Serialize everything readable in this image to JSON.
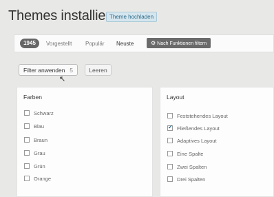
{
  "header": {
    "title": "Themes installieren",
    "upload_label": "Theme hochladen"
  },
  "filterbar": {
    "count": "1945",
    "tabs": [
      "Vorgestellt",
      "Populär",
      "Neuste"
    ],
    "active_tab": "Neuste",
    "feature_filter_label": "Nach Funktionen filtern"
  },
  "actions": {
    "apply_label": "Filter anwenden",
    "apply_count": "5",
    "clear_label": "Leeren"
  },
  "colors_panel": {
    "title": "Farben",
    "options": [
      {
        "label": "Schwarz",
        "checked": false
      },
      {
        "label": "Blau",
        "checked": false
      },
      {
        "label": "Braun",
        "checked": false
      },
      {
        "label": "Grau",
        "checked": false
      },
      {
        "label": "Grün",
        "checked": false
      },
      {
        "label": "Orange",
        "checked": false
      }
    ]
  },
  "layout_panel": {
    "title": "Layout",
    "options": [
      {
        "label": "Feststehendes Layout",
        "checked": false
      },
      {
        "label": "Fließendes Layout",
        "checked": true
      },
      {
        "label": "Adaptives Layout",
        "checked": false
      },
      {
        "label": "Eine Spalte",
        "checked": false
      },
      {
        "label": "Zwei Spalten",
        "checked": false
      },
      {
        "label": "Drei Spalten",
        "checked": false
      }
    ]
  }
}
